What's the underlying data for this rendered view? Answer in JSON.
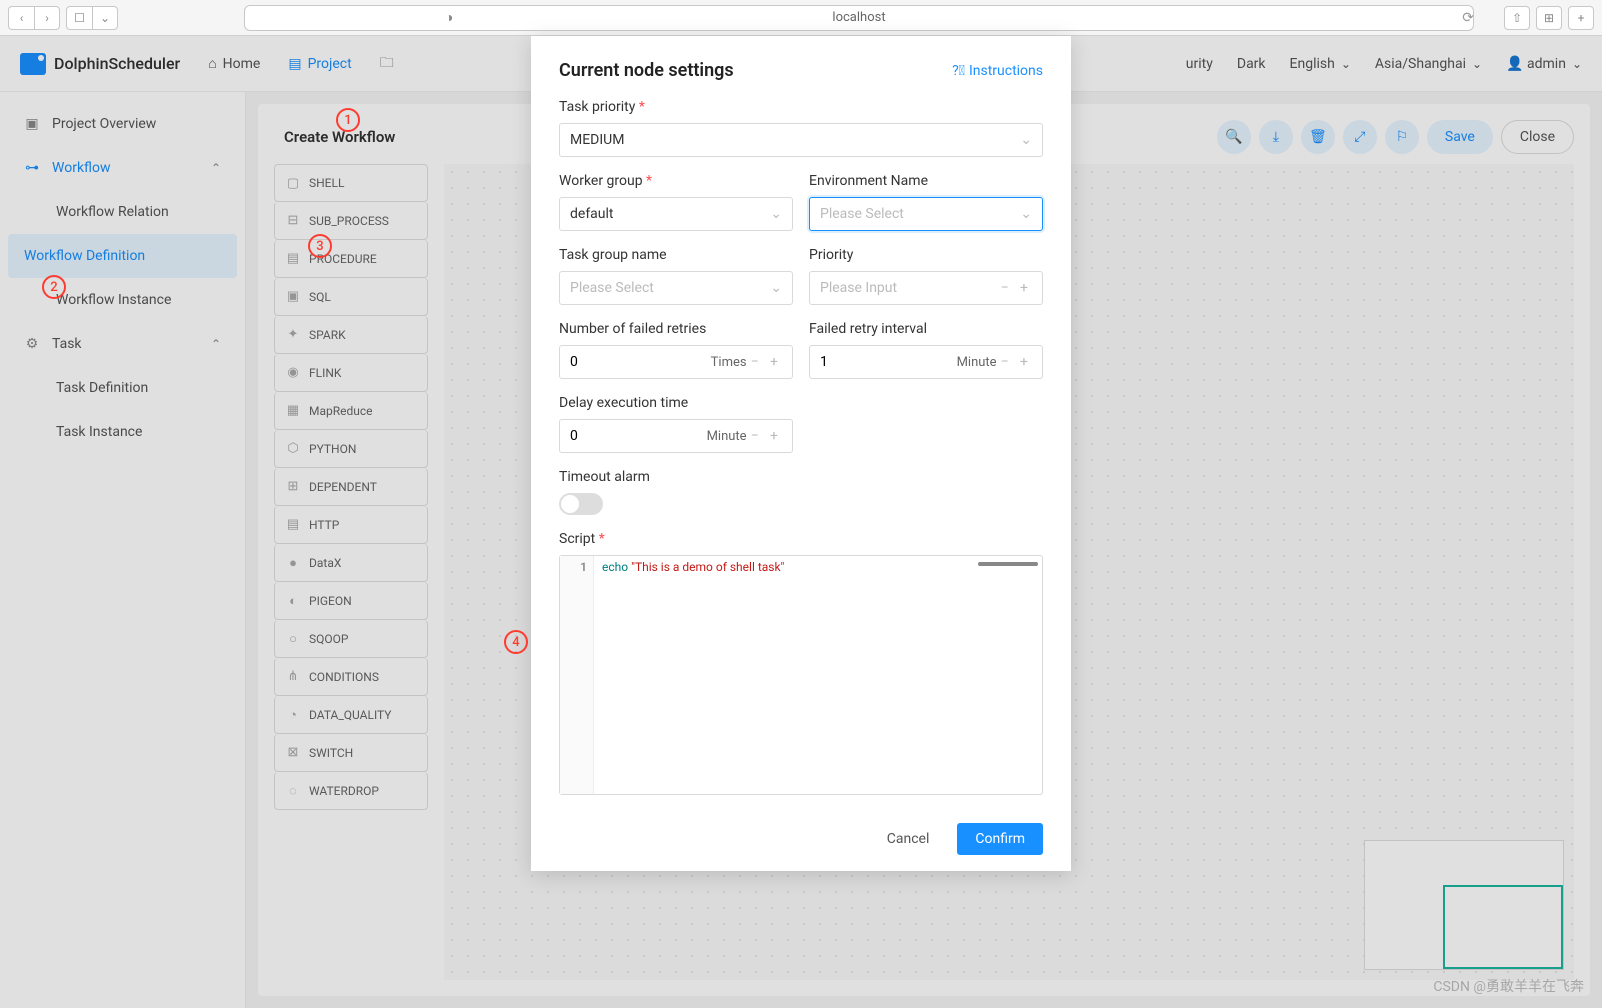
{
  "browser": {
    "url": "localhost"
  },
  "logo_text": "DolphinScheduler",
  "topnav": {
    "home": "Home",
    "project": "Project",
    "security_tail": "urity",
    "dark": "Dark",
    "english": "English",
    "tz": "Asia/Shanghai",
    "user": "admin"
  },
  "sidebar": {
    "overview": "Project Overview",
    "workflow": "Workflow",
    "relation": "Workflow Relation",
    "definition": "Workflow Definition",
    "instance": "Workflow Instance",
    "task": "Task",
    "task_def": "Task Definition",
    "task_inst": "Task Instance"
  },
  "page": {
    "title": "Create Workflow",
    "save": "Save",
    "close": "Close"
  },
  "task_types": [
    "SHELL",
    "SUB_PROCESS",
    "PROCEDURE",
    "SQL",
    "SPARK",
    "FLINK",
    "MapReduce",
    "PYTHON",
    "DEPENDENT",
    "HTTP",
    "DataX",
    "PIGEON",
    "SQOOP",
    "CONDITIONS",
    "DATA_QUALITY",
    "SWITCH",
    "WATERDROP"
  ],
  "anno": {
    "1": "1",
    "2": "2",
    "3": "3",
    "4": "4"
  },
  "modal": {
    "title": "Current node settings",
    "instructions": "Instructions",
    "priority_label": "Task priority",
    "priority_value": "MEDIUM",
    "worker_label": "Worker group",
    "worker_value": "default",
    "env_label": "Environment Name",
    "env_placeholder": "Please Select",
    "tgroup_label": "Task group name",
    "tgroup_placeholder": "Please Select",
    "prio2_label": "Priority",
    "prio2_placeholder": "Please Input",
    "retries_label": "Number of failed retries",
    "retries_value": "0",
    "retries_unit": "Times",
    "interval_label": "Failed retry interval",
    "interval_value": "1",
    "interval_unit": "Minute",
    "delay_label": "Delay execution time",
    "delay_value": "0",
    "delay_unit": "Minute",
    "timeout_label": "Timeout alarm",
    "script_label": "Script",
    "script_kw": "echo",
    "script_str": "\"This is a demo of shell task\"",
    "cancel": "Cancel",
    "confirm": "Confirm"
  },
  "watermark": "CSDN @勇敢羊羊在飞奔"
}
